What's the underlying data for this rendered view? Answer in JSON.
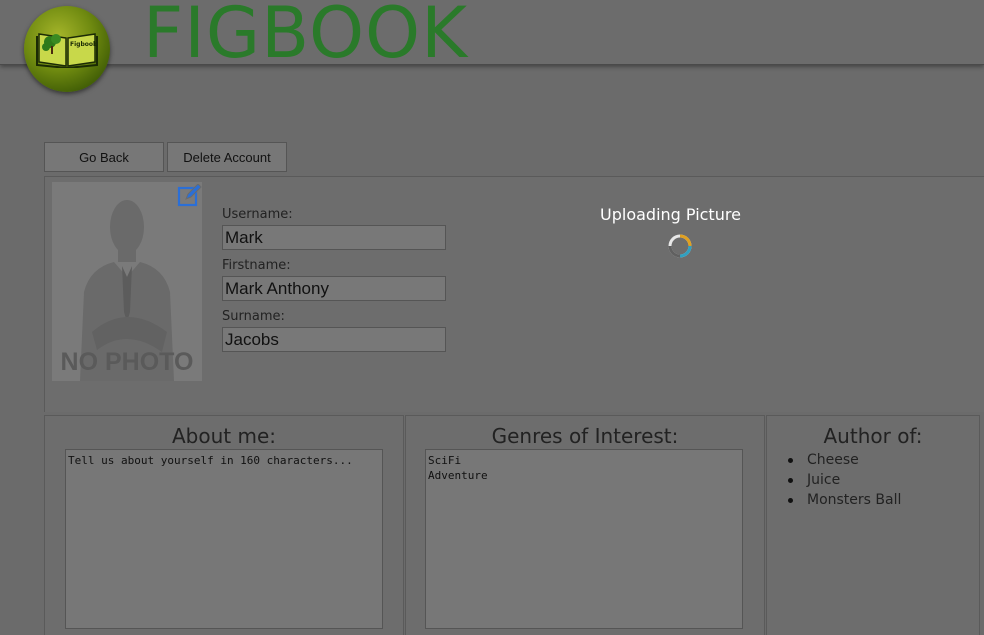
{
  "header": {
    "brand": "FIGBOOK",
    "logo_text": "Figbook"
  },
  "toolbar": {
    "back_label": "Go Back",
    "delete_label": "Delete Account"
  },
  "profile": {
    "photo_text": "NO PHOTO",
    "username_label": "Username:",
    "username_value": "Mark",
    "firstname_label": "Firstname:",
    "firstname_value": "Mark Anthony",
    "surname_label": "Surname:",
    "surname_value": "Jacobs",
    "upload_status": "Uploading Picture"
  },
  "about": {
    "title": "About me:",
    "text": "Tell us about yourself in 160 characters..."
  },
  "genres": {
    "title": "Genres of Interest:",
    "text": "SciFi\nAdventure"
  },
  "author": {
    "title": "Author of:",
    "items": [
      "Cheese",
      "Juice",
      "Monsters Ball"
    ]
  },
  "icons": {
    "edit": "edit-icon",
    "spinner": "loading-spinner-icon"
  },
  "colors": {
    "brand": "#2a7a2a",
    "overlay_gray": "#6b6b6b",
    "edit_icon": "#2b6fd6"
  }
}
